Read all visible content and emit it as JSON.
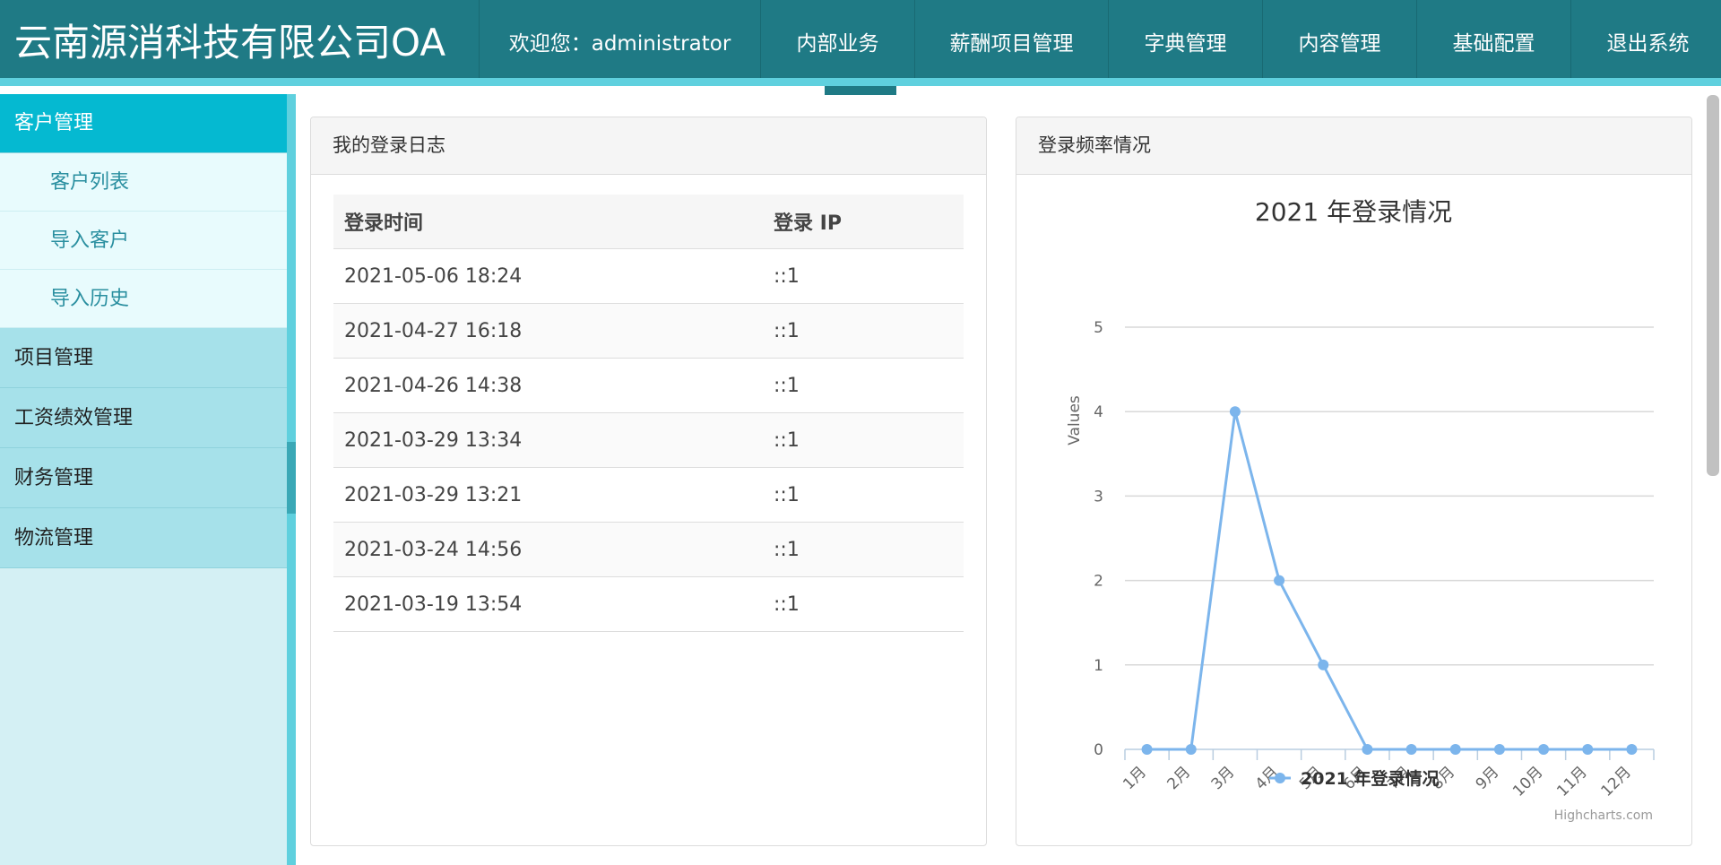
{
  "header": {
    "brand": "云南源消科技有限公司OA",
    "welcome": "欢迎您：administrator",
    "nav": [
      "内部业务",
      "薪酬项目管理",
      "字典管理",
      "内容管理",
      "基础配置",
      "退出系统"
    ]
  },
  "sidebar": {
    "groups": [
      {
        "label": "客户管理",
        "active": true,
        "items": [
          "客户列表",
          "导入客户",
          "导入历史"
        ]
      },
      {
        "label": "项目管理"
      },
      {
        "label": "工资绩效管理"
      },
      {
        "label": "财务管理"
      },
      {
        "label": "物流管理"
      }
    ]
  },
  "log_panel": {
    "title": "我的登录日志",
    "columns": [
      "登录时间",
      "登录 IP"
    ],
    "rows": [
      [
        "2021-05-06 18:24",
        "::1"
      ],
      [
        "2021-04-27 16:18",
        "::1"
      ],
      [
        "2021-04-26 14:38",
        "::1"
      ],
      [
        "2021-03-29 13:34",
        "::1"
      ],
      [
        "2021-03-29 13:21",
        "::1"
      ],
      [
        "2021-03-24 14:56",
        "::1"
      ],
      [
        "2021-03-19 13:54",
        "::1"
      ]
    ]
  },
  "chart_panel": {
    "title": "登录频率情况",
    "credit": "Highcharts.com"
  },
  "chart_data": {
    "type": "line",
    "title": "2021 年登录情况",
    "ylabel": "Values",
    "xlabel": "",
    "categories": [
      "1月",
      "2月",
      "3月",
      "4月",
      "5月",
      "6月",
      "7月",
      "8月",
      "9月",
      "10月",
      "11月",
      "12月"
    ],
    "series": [
      {
        "name": "2021 年登录情况",
        "values": [
          0,
          0,
          4,
          2,
          1,
          0,
          0,
          0,
          0,
          0,
          0,
          0
        ],
        "color": "#7cb5ec"
      }
    ],
    "ylim": [
      0,
      5
    ],
    "yticks": [
      0,
      1,
      2,
      3,
      4,
      5
    ],
    "grid": true,
    "legend": "bottom-center"
  },
  "colors": {
    "header": "#1f7a85",
    "accent": "#5fd0de",
    "active_menu": "#05b9d1",
    "series": "#7cb5ec"
  }
}
